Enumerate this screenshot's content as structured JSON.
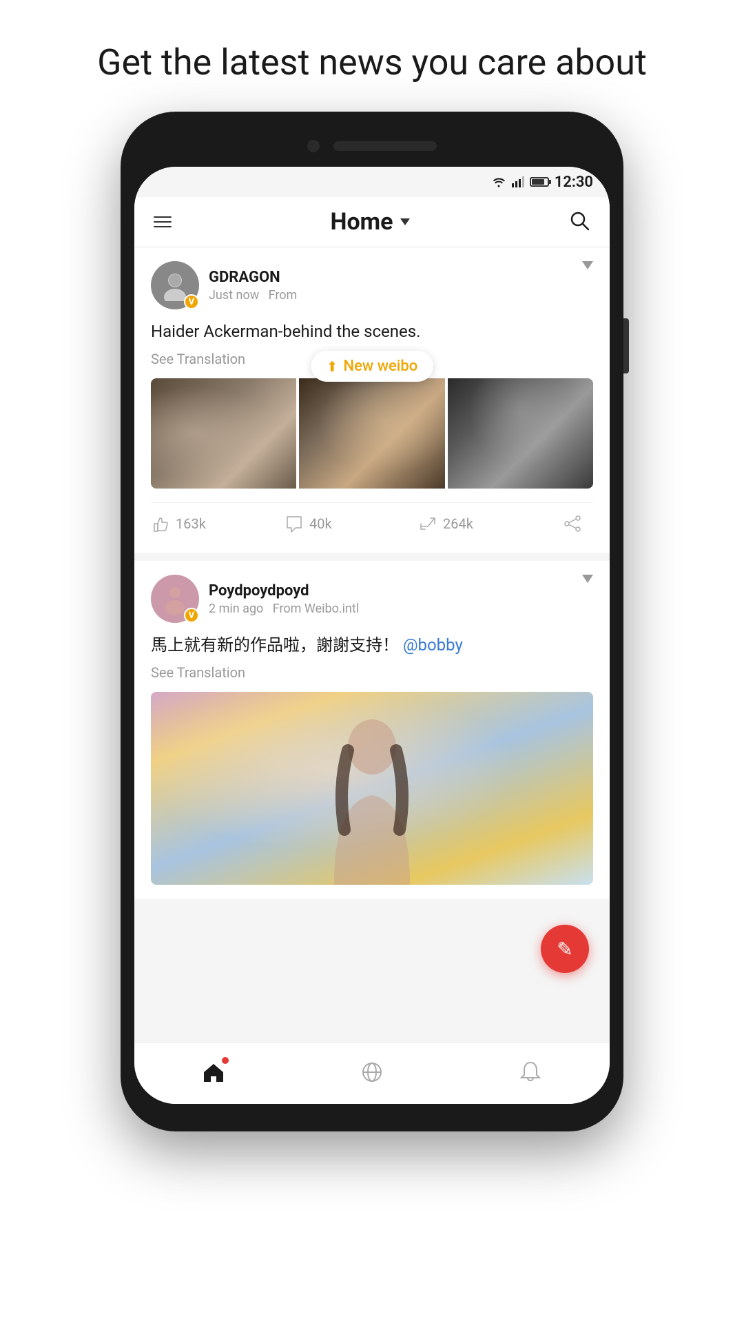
{
  "page": {
    "headline": "Get the latest news you care about"
  },
  "status_bar": {
    "time": "12:30"
  },
  "header": {
    "title": "Home",
    "menu_label": "Menu",
    "search_label": "Search"
  },
  "new_weibo_badge": {
    "text": "New weibo"
  },
  "posts": [
    {
      "id": "post1",
      "username": "GDRAGON",
      "time": "Just now",
      "source": "From",
      "content": "Haider Ackerman-behind the scenes.",
      "see_translation": "See Translation",
      "likes": "163k",
      "comments": "40k",
      "reposts": "264k"
    },
    {
      "id": "post2",
      "username": "Poydpoydpoyd",
      "time": "2 min ago",
      "source": "From Weibo.intl",
      "content": "馬上就有新的作品啦，謝謝支持！",
      "mention": "@bobby",
      "see_translation": "See Translation"
    }
  ],
  "nav": {
    "home_label": "Home",
    "explore_label": "Explore",
    "notifications_label": "Notifications"
  },
  "fab": {
    "label": "Compose"
  }
}
